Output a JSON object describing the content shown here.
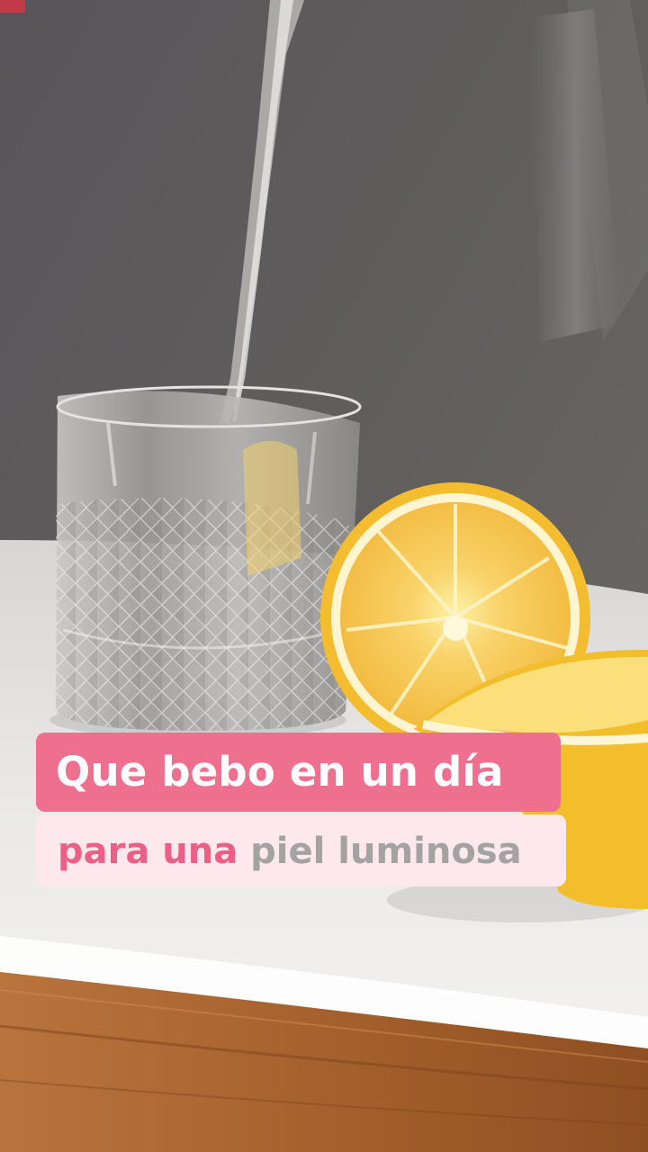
{
  "caption": {
    "line1": "Que bebo en un día",
    "line2_highlight": "para una",
    "line2_rest": "piel luminosa"
  },
  "colors": {
    "caption_bg_primary": "#ef6f8f",
    "caption_bg_secondary": "#fde8ee",
    "caption_text_primary": "#ffffff",
    "caption_text_pink": "#ee5f86",
    "caption_text_gray": "#a3a3a3"
  }
}
